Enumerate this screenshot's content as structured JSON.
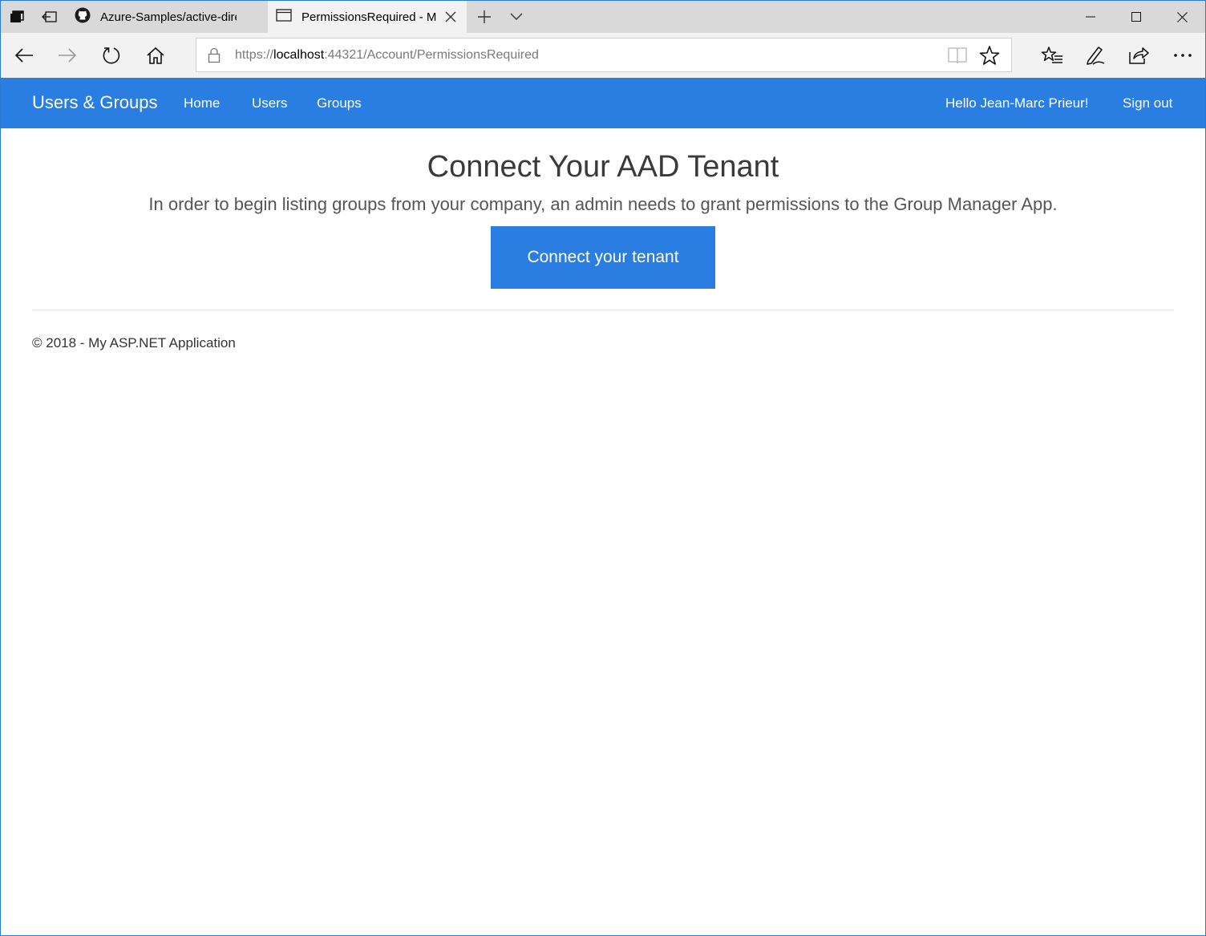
{
  "browser": {
    "tabs": [
      {
        "label": "Azure-Samples/active-direc",
        "icon": "github-icon"
      },
      {
        "label": "PermissionsRequired - M",
        "icon": "page-icon"
      }
    ],
    "address": {
      "scheme": "https://",
      "host": "localhost",
      "rest": ":44321/Account/PermissionsRequired"
    }
  },
  "navbar": {
    "brand": "Users & Groups",
    "links": [
      "Home",
      "Users",
      "Groups"
    ],
    "greeting": "Hello Jean-Marc Prieur!",
    "signout": "Sign out",
    "color": "#2a7ee2"
  },
  "main": {
    "title": "Connect Your AAD Tenant",
    "lead": "In order to begin listing groups from your company, an admin needs to grant permissions to the Group Manager App.",
    "button": "Connect your tenant"
  },
  "footer": {
    "text": "© 2018 - My ASP.NET Application"
  }
}
